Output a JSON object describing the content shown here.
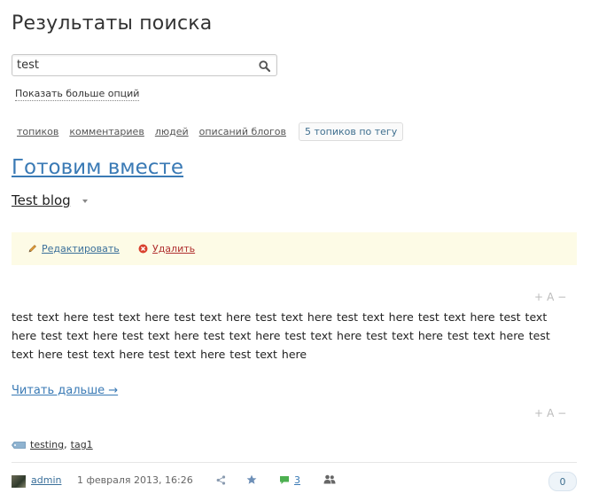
{
  "page": {
    "title": "Результаты поиска"
  },
  "search": {
    "value": "test",
    "icon": "search-icon"
  },
  "more_options": "Показать больше опций",
  "filters": [
    {
      "label": "топиков"
    },
    {
      "label": "комментариев"
    },
    {
      "label": "людей"
    },
    {
      "label": "описаний блогов"
    }
  ],
  "filter_active": "5 топиков по тегу",
  "post": {
    "title": "Готовим вместе",
    "blog": "Test blog",
    "actions": {
      "edit": "Редактировать",
      "delete": "Удалить"
    },
    "body": "test text here test text here test text here test text here test text here test text here test text here test text here test text here test text here test text here test text here test text here test text here test text here test text here test text here",
    "read_more": "Читать дальше →",
    "font_tools": {
      "increase": "+",
      "size": "A",
      "decrease": "−"
    },
    "tags": [
      "testing",
      "tag1"
    ],
    "footer": {
      "author": "admin",
      "date": "1 февраля 2013, 16:26",
      "comments": "3",
      "votes": "0"
    }
  },
  "colors": {
    "link": "#3a7ab5",
    "actions_bg": "#fdfbe6",
    "delete": "#b03030"
  }
}
